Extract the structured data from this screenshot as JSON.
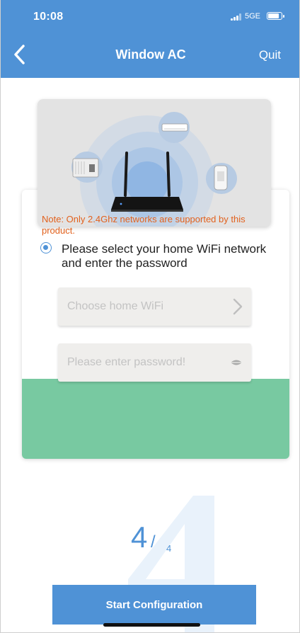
{
  "status_bar": {
    "time": "10:08",
    "network": "5GE"
  },
  "nav": {
    "title": "Window AC",
    "quit_label": "Quit"
  },
  "icons": {
    "back": "chevron-left-icon",
    "chevron": "chevron-right-icon",
    "password_toggle": "eye-icon"
  },
  "instruction": "Please select your home WiFi network and enter the password",
  "wifi_field": {
    "placeholder": "Choose home WiFi"
  },
  "password_field": {
    "placeholder": "Please enter password!"
  },
  "note": "Note: Only 2.4Ghz networks are supported by this product.",
  "step": {
    "current": "4",
    "separator": "/",
    "total": "4"
  },
  "start_button": "Start Configuration",
  "colors": {
    "primary": "#4f92d6",
    "note_bg": "#78c9a1",
    "note_text": "#e2611d"
  }
}
